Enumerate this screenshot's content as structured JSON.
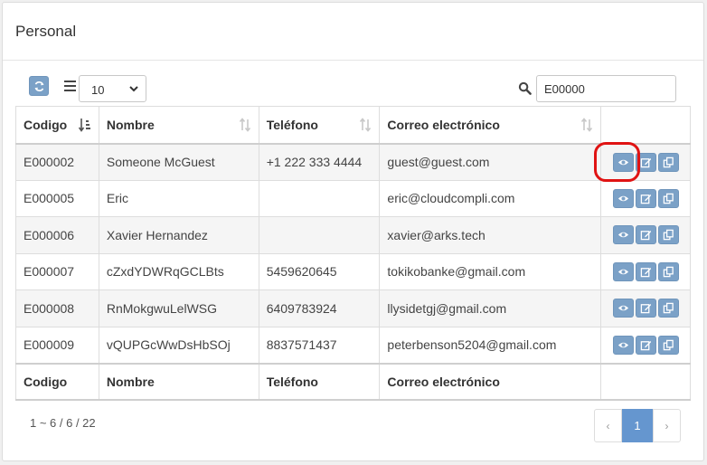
{
  "card": {
    "title": "Personal"
  },
  "toolbar": {
    "page_size": "10",
    "search_value": "E00000"
  },
  "table": {
    "columns": [
      "Codigo",
      "Nombre",
      "Teléfono",
      "Correo electrónico"
    ],
    "rows": [
      {
        "codigo": "E000002",
        "nombre": "Someone McGuest",
        "telefono": "+1 222 333 4444",
        "correo": "guest@guest.com"
      },
      {
        "codigo": "E000005",
        "nombre": "Eric",
        "telefono": "",
        "correo": "eric@cloudcompli.com"
      },
      {
        "codigo": "E000006",
        "nombre": "Xavier Hernandez",
        "telefono": "",
        "correo": "xavier@arks.tech"
      },
      {
        "codigo": "E000007",
        "nombre": "cZxdYDWRqGCLBts",
        "telefono": "5459620645",
        "correo": "tokikobanke@gmail.com"
      },
      {
        "codigo": "E000008",
        "nombre": "RnMokgwuLelWSG",
        "telefono": "6409783924",
        "correo": "llysidetgj@gmail.com"
      },
      {
        "codigo": "E000009",
        "nombre": "vQUPGcWwDsHbSOj",
        "telefono": "8837571437",
        "correo": "peterbenson5204@gmail.com"
      }
    ],
    "row_actions": [
      "eye-icon",
      "edit-icon",
      "copy-icon"
    ]
  },
  "footer": {
    "info": "1 ~ 6 / 6 / 22",
    "pagination": {
      "prev": "‹",
      "current": "1",
      "next": "›"
    }
  },
  "colors": {
    "accent": "#7ba1c7",
    "active_page": "#6596cf",
    "highlight": "#e01313"
  }
}
